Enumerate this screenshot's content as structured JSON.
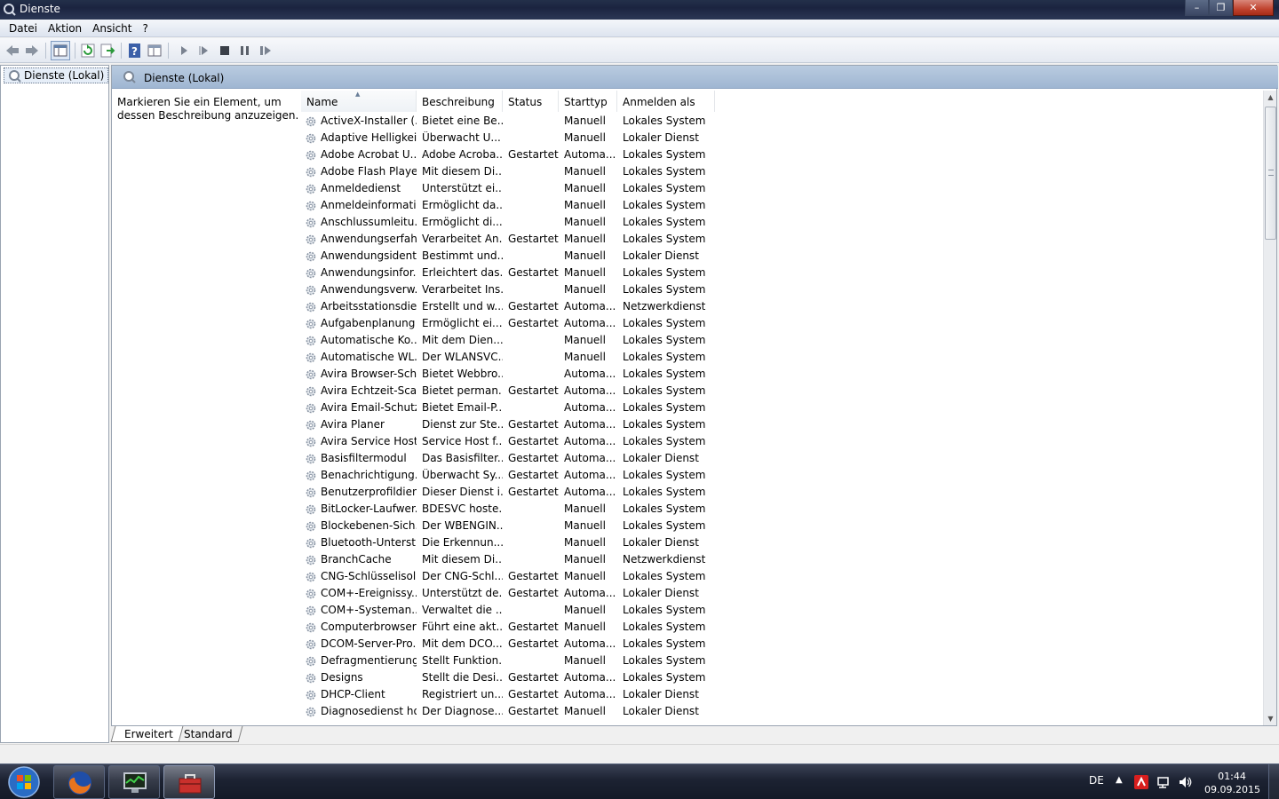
{
  "window": {
    "title": "Dienste"
  },
  "menu": [
    "Datei",
    "Aktion",
    "Ansicht",
    "?"
  ],
  "tree": {
    "item": "Dienste (Lokal)"
  },
  "pane": {
    "header": "Dienste (Lokal)",
    "description": "Markieren Sie ein Element, um dessen Beschreibung anzuzeigen."
  },
  "columns": [
    "Name",
    "Beschreibung",
    "Status",
    "Starttyp",
    "Anmelden als"
  ],
  "rows": [
    [
      "ActiveX-Installer (...",
      "Bietet eine Be...",
      "",
      "Manuell",
      "Lokales System"
    ],
    [
      "Adaptive Helligkeit",
      "Überwacht U...",
      "",
      "Manuell",
      "Lokaler Dienst"
    ],
    [
      "Adobe Acrobat U...",
      "Adobe Acroba...",
      "Gestartet",
      "Automa...",
      "Lokales System"
    ],
    [
      "Adobe Flash Playe...",
      "Mit diesem Di...",
      "",
      "Manuell",
      "Lokales System"
    ],
    [
      "Anmeldedienst",
      "Unterstützt ei...",
      "",
      "Manuell",
      "Lokales System"
    ],
    [
      "Anmeldeinformati...",
      "Ermöglicht da...",
      "",
      "Manuell",
      "Lokales System"
    ],
    [
      "Anschlussumleitu...",
      "Ermöglicht di...",
      "",
      "Manuell",
      "Lokales System"
    ],
    [
      "Anwendungserfah...",
      "Verarbeitet An...",
      "Gestartet",
      "Manuell",
      "Lokales System"
    ],
    [
      "Anwendungsident...",
      "Bestimmt und...",
      "",
      "Manuell",
      "Lokaler Dienst"
    ],
    [
      "Anwendungsinfor...",
      "Erleichtert das...",
      "Gestartet",
      "Manuell",
      "Lokales System"
    ],
    [
      "Anwendungsverw...",
      "Verarbeitet Ins...",
      "",
      "Manuell",
      "Lokales System"
    ],
    [
      "Arbeitsstationsdie...",
      "Erstellt und w...",
      "Gestartet",
      "Automa...",
      "Netzwerkdienst"
    ],
    [
      "Aufgabenplanung",
      "Ermöglicht ei...",
      "Gestartet",
      "Automa...",
      "Lokales System"
    ],
    [
      "Automatische Ko...",
      "Mit dem Dien...",
      "",
      "Manuell",
      "Lokales System"
    ],
    [
      "Automatische WL...",
      "Der WLANSVC...",
      "",
      "Manuell",
      "Lokales System"
    ],
    [
      "Avira Browser-Sch...",
      "Bietet Webbro...",
      "",
      "Automa...",
      "Lokales System"
    ],
    [
      "Avira Echtzeit-Sca...",
      "Bietet perman...",
      "Gestartet",
      "Automa...",
      "Lokales System"
    ],
    [
      "Avira Email-Schutz",
      "Bietet Email-P...",
      "",
      "Automa...",
      "Lokales System"
    ],
    [
      "Avira Planer",
      "Dienst zur Ste...",
      "Gestartet",
      "Automa...",
      "Lokales System"
    ],
    [
      "Avira Service Host",
      "Service Host f...",
      "Gestartet",
      "Automa...",
      "Lokales System"
    ],
    [
      "Basisfiltermodul",
      "Das Basisfilter...",
      "Gestartet",
      "Automa...",
      "Lokaler Dienst"
    ],
    [
      "Benachrichtigung...",
      "Überwacht Sy...",
      "Gestartet",
      "Automa...",
      "Lokales System"
    ],
    [
      "Benutzerprofildienst",
      "Dieser Dienst i...",
      "Gestartet",
      "Automa...",
      "Lokales System"
    ],
    [
      "BitLocker-Laufwer...",
      "BDESVC hoste...",
      "",
      "Manuell",
      "Lokales System"
    ],
    [
      "Blockebenen-Sich...",
      "Der WBENGIN...",
      "",
      "Manuell",
      "Lokales System"
    ],
    [
      "Bluetooth-Unterst...",
      "Die Erkennun...",
      "",
      "Manuell",
      "Lokaler Dienst"
    ],
    [
      "BranchCache",
      "Mit diesem Di...",
      "",
      "Manuell",
      "Netzwerkdienst"
    ],
    [
      "CNG-Schlüsselisol...",
      "Der CNG-Schl...",
      "Gestartet",
      "Manuell",
      "Lokales System"
    ],
    [
      "COM+-Ereignissy...",
      "Unterstützt de...",
      "Gestartet",
      "Automa...",
      "Lokaler Dienst"
    ],
    [
      "COM+-Systeman...",
      "Verwaltet die ...",
      "",
      "Manuell",
      "Lokales System"
    ],
    [
      "Computerbrowser",
      "Führt eine akt...",
      "Gestartet",
      "Manuell",
      "Lokales System"
    ],
    [
      "DCOM-Server-Pro...",
      "Mit dem DCO...",
      "Gestartet",
      "Automa...",
      "Lokales System"
    ],
    [
      "Defragmentierung",
      "Stellt Funktion...",
      "",
      "Manuell",
      "Lokales System"
    ],
    [
      "Designs",
      "Stellt die Desi...",
      "Gestartet",
      "Automa...",
      "Lokales System"
    ],
    [
      "DHCP-Client",
      "Registriert un...",
      "Gestartet",
      "Automa...",
      "Lokaler Dienst"
    ],
    [
      "Diagnosedienst host",
      "Der Diagnose...",
      "Gestartet",
      "Manuell",
      "Lokaler Dienst"
    ]
  ],
  "tabs": [
    "Erweitert",
    "Standard"
  ],
  "tray": {
    "language": "DE",
    "time": "01:44",
    "date": "09.09.2015"
  },
  "colors": {
    "header": "#9fb6d2",
    "taskbar": "#1c2232"
  }
}
